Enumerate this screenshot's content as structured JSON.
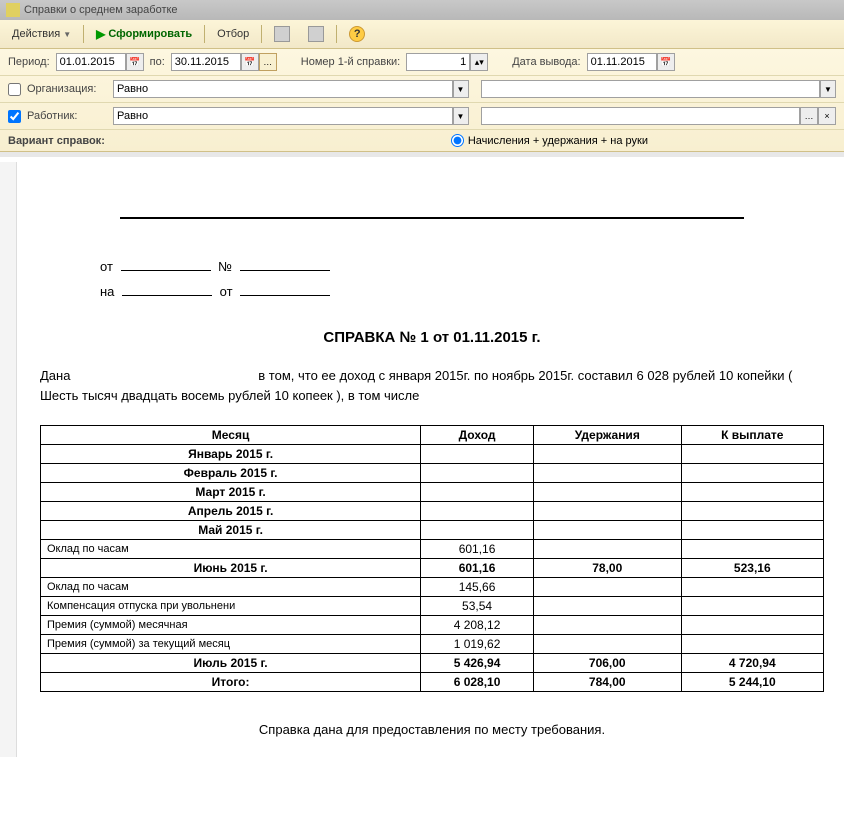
{
  "window": {
    "title": "Справки о среднем заработке"
  },
  "toolbar": {
    "actions": "Действия",
    "form": "Сформировать",
    "filter": "Отбор"
  },
  "filters": {
    "period_label": "Период:",
    "period_from": "01.01.2015",
    "period_to_label": "по:",
    "period_to": "30.11.2015",
    "ref_num_label": "Номер 1-й справки:",
    "ref_num": "1",
    "output_date_label": "Дата вывода:",
    "output_date": "01.11.2015",
    "org_label": "Организация:",
    "org_op": "Равно",
    "worker_label": "Работник:",
    "worker_op": "Равно",
    "variant_label": "Вариант справок:",
    "variant_radio": "Начисления + удержания + на руки"
  },
  "document": {
    "meta_from": "от",
    "meta_num": "№",
    "meta_na": "на",
    "meta_ot": "от",
    "title": "СПРАВКА № 1 от 01.11.2015 г.",
    "intro_prefix": "Дана",
    "intro_text": "в том, что  ее доход с января 2015г. по ноябрь 2015г. составил 6 028 рублей 10 копейки ( Шесть тысяч двадцать восемь рублей 10 копеек ), в том числе",
    "table": {
      "headers": [
        "Месяц",
        "Доход",
        "Удержания",
        "К выплате"
      ],
      "rows": [
        {
          "type": "month",
          "label": "Январь 2015 г."
        },
        {
          "type": "month",
          "label": "Февраль 2015 г."
        },
        {
          "type": "month",
          "label": "Март 2015 г."
        },
        {
          "type": "month",
          "label": "Апрель 2015 г."
        },
        {
          "type": "month",
          "label": "Май 2015 г."
        },
        {
          "type": "detail",
          "label": "Оклад по часам",
          "income": "601,16"
        },
        {
          "type": "subtotal",
          "label": "Июнь 2015 г.",
          "income": "601,16",
          "withhold": "78,00",
          "pay": "523,16"
        },
        {
          "type": "detail",
          "label": "Оклад по часам",
          "income": "145,66"
        },
        {
          "type": "detail",
          "label": "Компенсация отпуска при увольнени",
          "income": "53,54"
        },
        {
          "type": "detail",
          "label": "Премия (суммой) месячная",
          "income": "4 208,12"
        },
        {
          "type": "detail",
          "label": "Премия (суммой) за текущий месяц",
          "income": "1 019,62"
        },
        {
          "type": "subtotal",
          "label": "Июль 2015 г.",
          "income": "5 426,94",
          "withhold": "706,00",
          "pay": "4 720,94"
        },
        {
          "type": "total",
          "label": "Итого:",
          "income": "6 028,10",
          "withhold": "784,00",
          "pay": "5 244,10"
        }
      ]
    },
    "footer": "Справка дана для предоставления по месту требования."
  }
}
